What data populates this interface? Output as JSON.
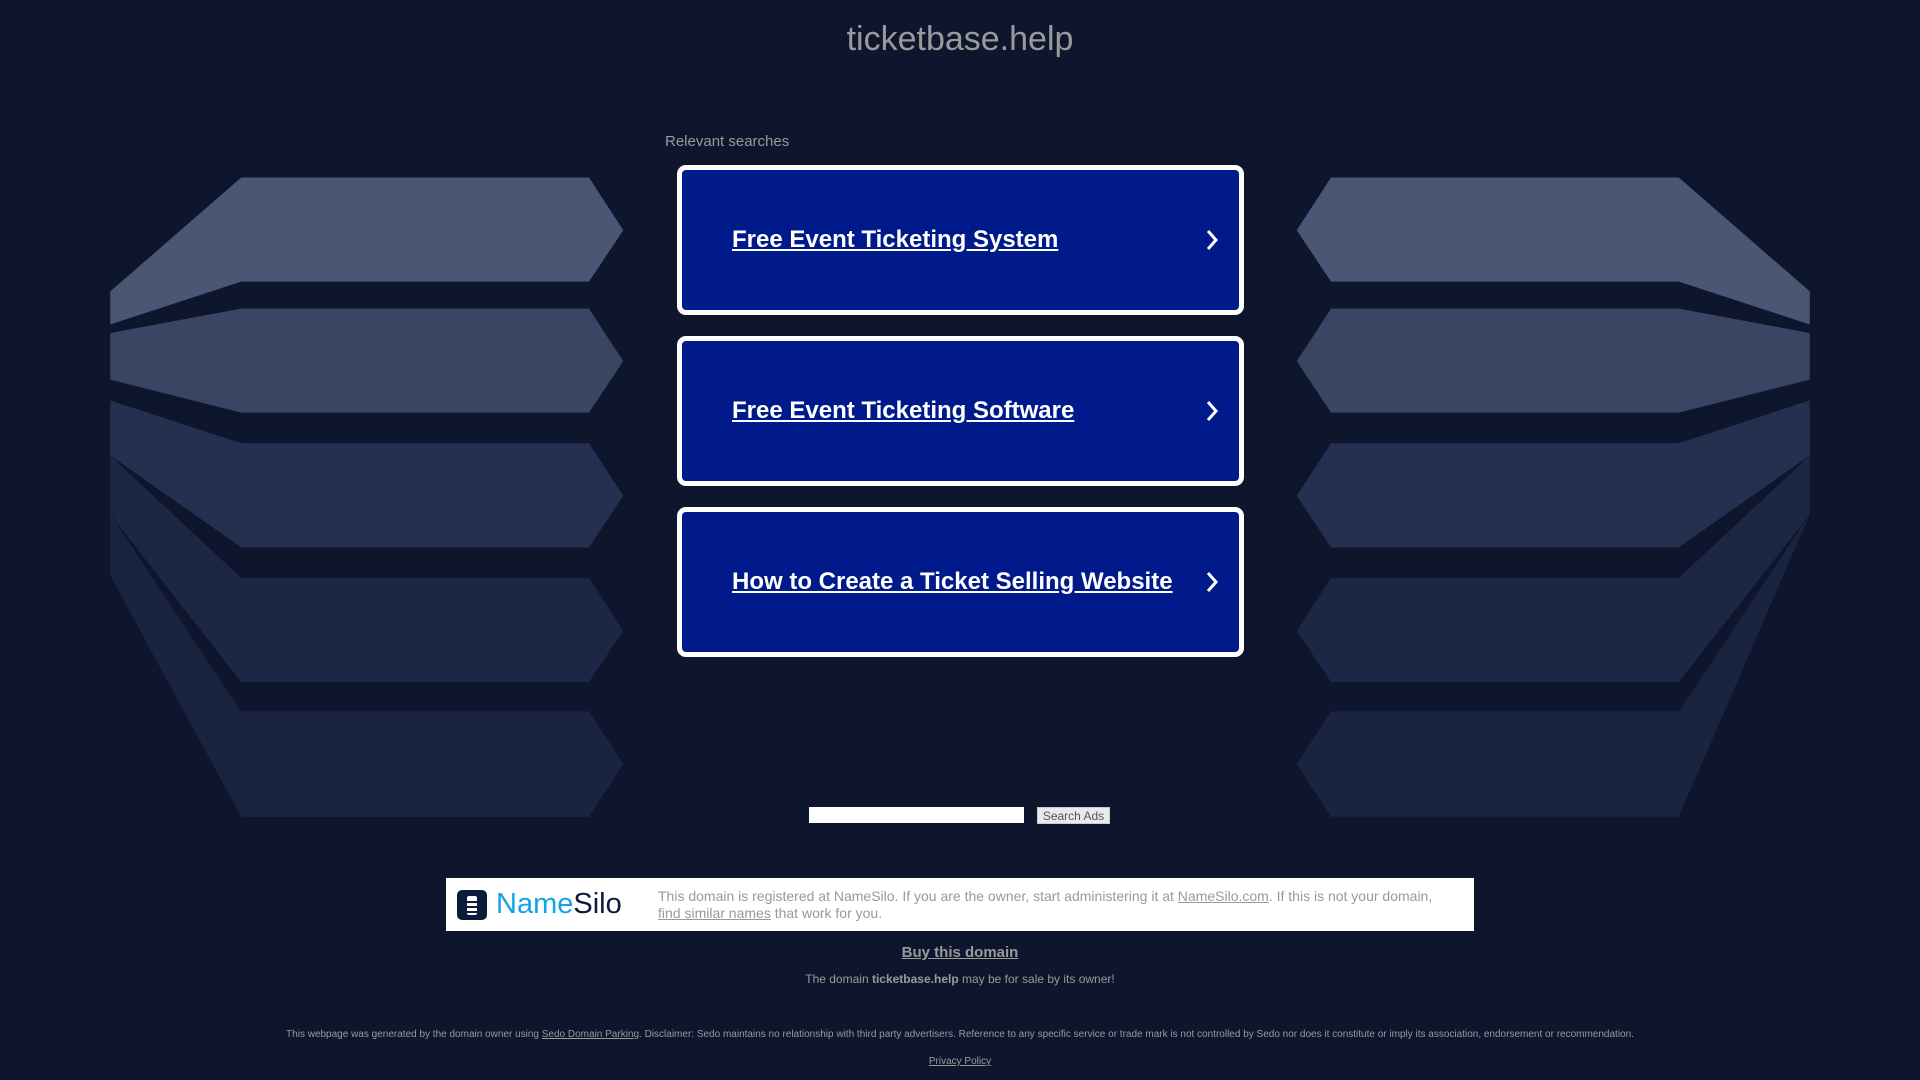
{
  "header": {
    "title": "ticketbase.help"
  },
  "relevant_label": "Relevant searches",
  "ads": [
    {
      "label": "Free Event Ticketing System"
    },
    {
      "label": "Free Event Ticketing Software"
    },
    {
      "label": "How to Create a Ticket Selling Website"
    }
  ],
  "search": {
    "value": "",
    "button": "Search Ads"
  },
  "namesilo": {
    "logo_a": "Name",
    "logo_b": "Silo",
    "text1": "This domain is registered at NameSilo. If you are the owner, start administering it at ",
    "link1": "NameSilo.com",
    "text2": ". If this is not your domain, ",
    "link2": "find similar names",
    "text3": " that work for you."
  },
  "buy": {
    "label": "Buy this domain"
  },
  "sale": {
    "pre": "The domain ",
    "domain": "ticketbase.help",
    "post": " may be for sale by its owner!"
  },
  "disclaimer": {
    "pre": "This webpage was generated by the domain owner using ",
    "link": "Sedo Domain Parking",
    "post": ". Disclaimer: Sedo maintains no relationship with third party advertisers. Reference to any specific service or trade mark is not controlled by Sedo nor does it constitute or imply its association, endorsement or recommendation."
  },
  "privacy": "Privacy Policy",
  "colors": {
    "bg": "#0e162d",
    "ad": "#011a8b",
    "accent": "#12a4e6"
  }
}
